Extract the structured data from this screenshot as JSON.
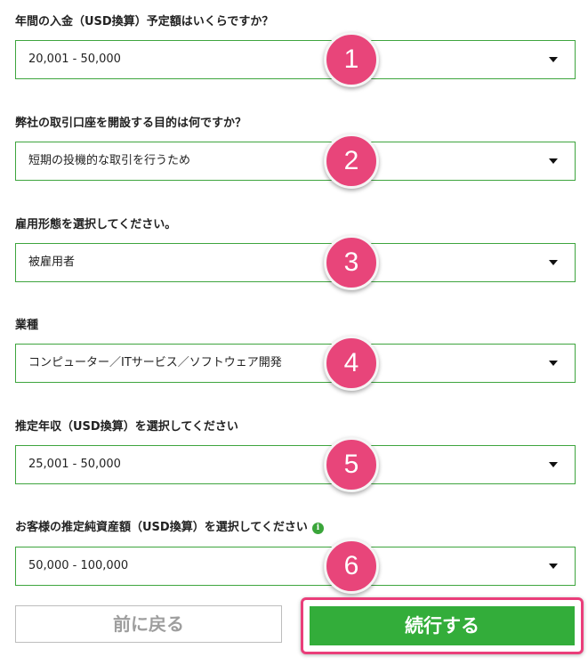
{
  "fields": [
    {
      "label": "年間の入金（USD換算）予定額はいくらですか？",
      "value": "20,001 - 50,000",
      "step": "1"
    },
    {
      "label": "弊社の取引口座を開設する目的は何ですか？",
      "value": "短期の投機的な取引を行うため",
      "step": "2"
    },
    {
      "label": "雇用形態を選択してください。",
      "value": "被雇用者",
      "step": "3"
    },
    {
      "label": "業種",
      "value": "コンピューター／ITサービス／ソフトウェア開発",
      "step": "4"
    },
    {
      "label": "推定年収（USD換算）を選択してください",
      "value": "25,001 - 50,000",
      "step": "5"
    },
    {
      "label": "お客様の推定純資産額（USD換算）を選択してください",
      "value": "50,000 - 100,000",
      "step": "6",
      "has_info": true
    }
  ],
  "buttons": {
    "back_label": "前に戻る",
    "continue_label": "続行する"
  },
  "icons": {
    "info": "info-icon",
    "dropdown": "caret-down-icon"
  },
  "colors": {
    "border_green": "#3ea53e",
    "button_green": "#33ad3a",
    "badge_pink": "#e8457a",
    "highlight_pink": "#ea3e7a"
  }
}
